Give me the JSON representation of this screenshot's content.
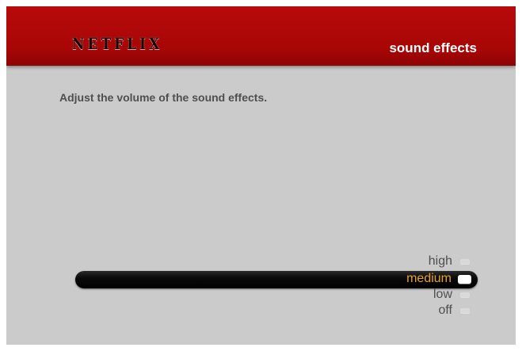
{
  "header": {
    "logo_text": "NETFLIX",
    "title": "sound effects"
  },
  "main": {
    "instruction": "Adjust the volume of the sound effects."
  },
  "volume_options": {
    "items": [
      {
        "label": "high",
        "selected": false
      },
      {
        "label": "medium",
        "selected": true
      },
      {
        "label": "low",
        "selected": false
      },
      {
        "label": "off",
        "selected": false
      }
    ],
    "selected_value": "medium"
  },
  "colors": {
    "header_red": "#a90606",
    "background_gray": "#cbcbcb",
    "selected_text": "#e7a21e",
    "selection_bar": "#000000",
    "text_gray": "#4f4f4f"
  }
}
